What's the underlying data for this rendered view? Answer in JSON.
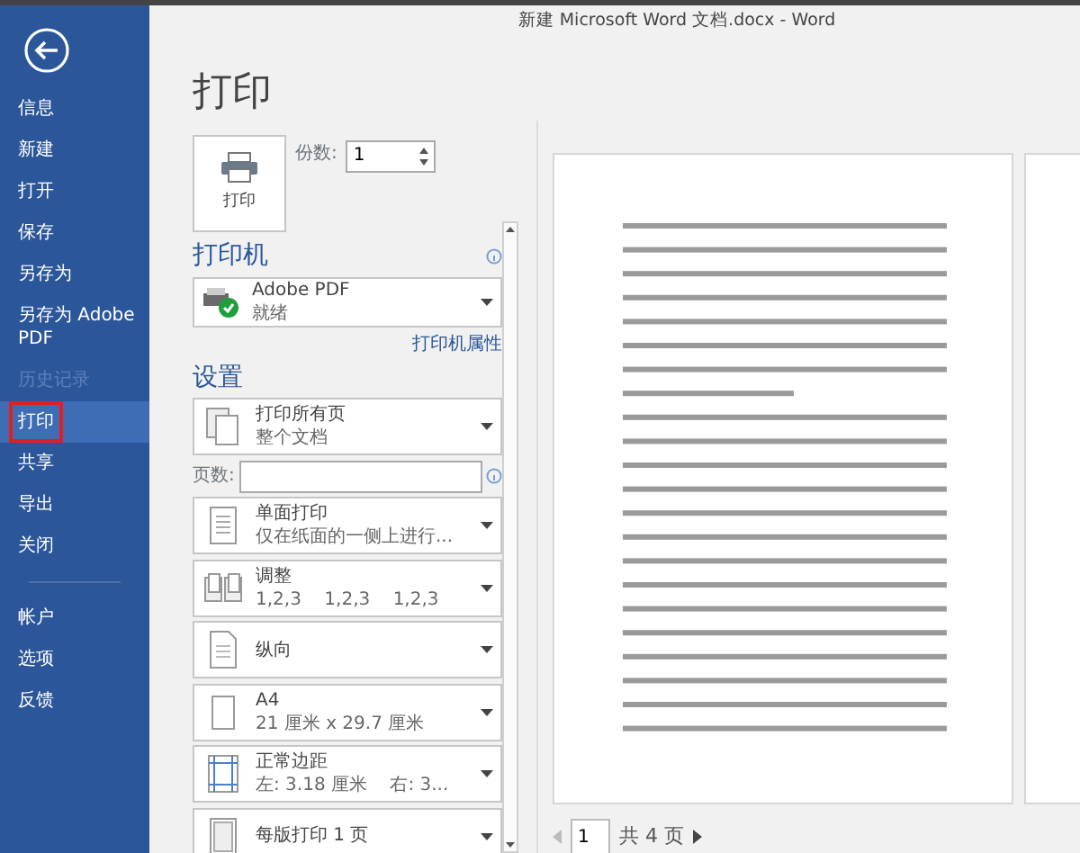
{
  "window": {
    "title": "新建 Microsoft Word 文档.docx - Word"
  },
  "sidebar": {
    "items": [
      {
        "label": "信息",
        "selected": false,
        "disabled": false,
        "highlighted": false
      },
      {
        "label": "新建",
        "selected": false,
        "disabled": false,
        "highlighted": false
      },
      {
        "label": "打开",
        "selected": false,
        "disabled": false,
        "highlighted": false
      },
      {
        "label": "保存",
        "selected": false,
        "disabled": false,
        "highlighted": false
      },
      {
        "label": "另存为",
        "selected": false,
        "disabled": false,
        "highlighted": false
      },
      {
        "label": "另存为 Adobe PDF",
        "selected": false,
        "disabled": false,
        "highlighted": false
      },
      {
        "label": "历史记录",
        "selected": false,
        "disabled": true,
        "highlighted": false
      },
      {
        "label": "打印",
        "selected": true,
        "disabled": false,
        "highlighted": true
      },
      {
        "label": "共享",
        "selected": false,
        "disabled": false,
        "highlighted": false
      },
      {
        "label": "导出",
        "selected": false,
        "disabled": false,
        "highlighted": false
      },
      {
        "label": "关闭",
        "selected": false,
        "disabled": false,
        "highlighted": false
      }
    ],
    "bottom_items": [
      {
        "label": "帐户",
        "selected": false
      },
      {
        "label": "选项",
        "selected": false
      },
      {
        "label": "反馈",
        "selected": false
      }
    ]
  },
  "print": {
    "heading": "打印",
    "print_button": "打印",
    "copies": {
      "label": "份数:",
      "value": "1"
    }
  },
  "printer": {
    "heading": "打印机",
    "name": "Adobe PDF",
    "status": "就绪",
    "properties_link": "打印机属性"
  },
  "settings": {
    "heading": "设置",
    "options": [
      {
        "kind": "dropdown",
        "line1": "打印所有页",
        "line2": "整个文档"
      },
      {
        "kind": "field",
        "label": "页数:"
      },
      {
        "kind": "dropdown",
        "line1": "单面打印",
        "line2": "仅在纸面的一侧上进行..."
      },
      {
        "kind": "dropdown",
        "line1": "调整",
        "line2": "1,2,3    1,2,3    1,2,3"
      },
      {
        "kind": "dropdown",
        "line1": "纵向"
      },
      {
        "kind": "dropdown",
        "line1": "A4",
        "line2": "21 厘米 x 29.7 厘米"
      },
      {
        "kind": "dropdown",
        "line1": "正常边距",
        "line2": "左: 3.18 厘米    右: 3..."
      },
      {
        "kind": "dropdown",
        "line1": "每版打印 1 页"
      }
    ]
  },
  "preview": {
    "current_page": "1",
    "total": "共 4 页"
  }
}
